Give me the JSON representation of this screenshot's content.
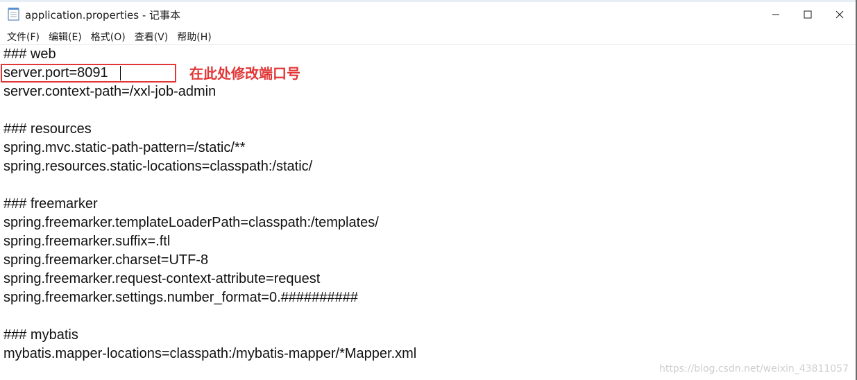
{
  "window": {
    "title": "application.properties - 记事本"
  },
  "menu": {
    "items": [
      "文件(F)",
      "编辑(E)",
      "格式(O)",
      "查看(V)",
      "帮助(H)"
    ]
  },
  "editor": {
    "lines": [
      "### web",
      "server.port=8091",
      "server.context-path=/xxl-job-admin",
      "",
      "### resources",
      "spring.mvc.static-path-pattern=/static/**",
      "spring.resources.static-locations=classpath:/static/",
      "",
      "### freemarker",
      "spring.freemarker.templateLoaderPath=classpath:/templates/",
      "spring.freemarker.suffix=.ftl",
      "spring.freemarker.charset=UTF-8",
      "spring.freemarker.request-context-attribute=request",
      "spring.freemarker.settings.number_format=0.##########",
      "",
      "### mybatis",
      "mybatis.mapper-locations=classpath:/mybatis-mapper/*Mapper.xml"
    ]
  },
  "annotation": {
    "text": "在此处修改端口号",
    "color": "#e23535"
  },
  "watermark": {
    "text": "https://blog.csdn.net/weixin_43811057"
  }
}
